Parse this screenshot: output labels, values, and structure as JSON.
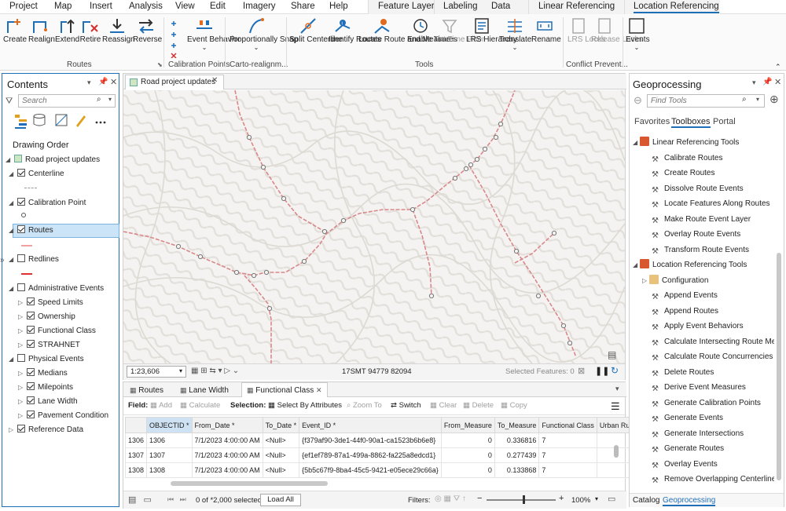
{
  "menubar": {
    "items": [
      "Project",
      "Map",
      "Insert",
      "Analysis",
      "View",
      "Edit",
      "Imagery",
      "Share",
      "Help"
    ],
    "context_tabs": [
      "Feature Layer",
      "Labeling",
      "Data",
      "Linear Referencing",
      "Location Referencing"
    ]
  },
  "ribbon": {
    "groups": {
      "routes": {
        "label": "Routes",
        "buttons": [
          "Create",
          "Realign",
          "Extend",
          "Retire",
          "Reassign",
          "Reverse"
        ]
      },
      "calibration": {
        "label": "Calibration Points",
        "buttons": [
          "Event Behavior"
        ]
      },
      "carto": {
        "label": "Carto-realignm...",
        "buttons": [
          "Proportionally Snap"
        ]
      },
      "tools": {
        "label": "Tools",
        "buttons": [
          "Split Centerline",
          "Identify Routes",
          "Locate Route and Measures",
          "Enable Time",
          "Set Time Filter",
          "LRS Hierarchy",
          "Translate",
          "Rename"
        ]
      },
      "conflict": {
        "label": "Conflict Prevent...",
        "buttons": [
          "LRS Locks",
          "Release Locks"
        ]
      },
      "events": {
        "label": "",
        "buttons": [
          "Events"
        ]
      }
    }
  },
  "contents": {
    "title": "Contents",
    "search_placeholder": "Search",
    "drawing_order": "Drawing Order",
    "map_name": "Road project updates",
    "layers": [
      {
        "label": "Centerline",
        "checked": true
      },
      {
        "label": "Calibration Point",
        "checked": true
      },
      {
        "label": "Routes",
        "checked": true,
        "selected": true
      },
      {
        "label": "Redlines",
        "checked": false
      },
      {
        "label": "Administrative Events",
        "checked": false
      },
      {
        "label": "Speed Limits",
        "checked": true
      },
      {
        "label": "Ownership",
        "checked": true
      },
      {
        "label": "Functional Class",
        "checked": true
      },
      {
        "label": "STRAHNET",
        "checked": true
      },
      {
        "label": "Physical Events",
        "checked": false
      },
      {
        "label": "Medians",
        "checked": true
      },
      {
        "label": "Milepoints",
        "checked": true
      },
      {
        "label": "Lane Width",
        "checked": true
      },
      {
        "label": "Pavement Condition",
        "checked": true
      },
      {
        "label": "Reference Data",
        "checked": true
      }
    ]
  },
  "map": {
    "tab_title": "Road project updates",
    "scale": "1:23,606",
    "coordinates": "17SMT 94779 82094",
    "selected_features": "Selected Features: 0"
  },
  "attribute_table": {
    "tabs": [
      "Routes",
      "Lane Width",
      "Functional Class"
    ],
    "field_label": "Field:",
    "field_buttons": [
      "Add",
      "Calculate"
    ],
    "selection_label": "Selection:",
    "selection_buttons": [
      "Select By Attributes",
      "Zoom To",
      "Switch",
      "Clear",
      "Delete",
      "Copy"
    ],
    "columns": [
      "OBJECTID *",
      "From_Date *",
      "To_Date *",
      "Event_ID *",
      "From_Measure",
      "To_Measure",
      "Functional Class",
      "Urban Ru"
    ],
    "rows": [
      {
        "n": "1306",
        "objectid": "1306",
        "from_date": "7/1/2023 4:00:00 AM",
        "to_date": "<Null>",
        "event_id": "{f379af90-3de1-44f0-90a1-ca1523b6b6e8}",
        "from_measure": "0",
        "to_measure": "0.336816",
        "fclass": "7"
      },
      {
        "n": "1307",
        "objectid": "1307",
        "from_date": "7/1/2023 4:00:00 AM",
        "to_date": "<Null>",
        "event_id": "{ef1ef789-87a1-499a-8862-fa225a8edcd1}",
        "from_measure": "0",
        "to_measure": "0.277439",
        "fclass": "7"
      },
      {
        "n": "1308",
        "objectid": "1308",
        "from_date": "7/1/2023 4:00:00 AM",
        "to_date": "<Null>",
        "event_id": "{5b5c67f9-8ba4-45c5-9421-e05ece29c66a}",
        "from_measure": "0",
        "to_measure": "0.133868",
        "fclass": "7"
      }
    ],
    "status": "0 of *2,000 selected",
    "load_all": "Load All",
    "filters": "Filters:",
    "zoom": "100%"
  },
  "geoprocessing": {
    "title": "Geoprocessing",
    "search_placeholder": "Find Tools",
    "tabs": [
      "Favorites",
      "Toolboxes",
      "Portal"
    ],
    "linear_ref": "Linear Referencing Tools",
    "linear_tools": [
      "Calibrate Routes",
      "Create Routes",
      "Dissolve Route Events",
      "Locate Features Along Routes",
      "Make Route Event Layer",
      "Overlay Route Events",
      "Transform Route Events"
    ],
    "location_ref": "Location Referencing Tools",
    "configuration": "Configuration",
    "location_tools": [
      "Append Events",
      "Append Routes",
      "Apply Event Behaviors",
      "Calculate Intersecting Route Measu",
      "Calculate Route Concurrencies",
      "Delete Routes",
      "Derive Event Measures",
      "Generate Calibration Points",
      "Generate Events",
      "Generate Intersections",
      "Generate Routes",
      "Overlay Events",
      "Remove Overlapping Centerlines"
    ],
    "bottom_tabs": [
      "Catalog",
      "Geoprocessing"
    ]
  },
  "colors": {
    "accent": "#1f6fb8",
    "route": "#d9888a",
    "highlight": "#cce4f7"
  }
}
